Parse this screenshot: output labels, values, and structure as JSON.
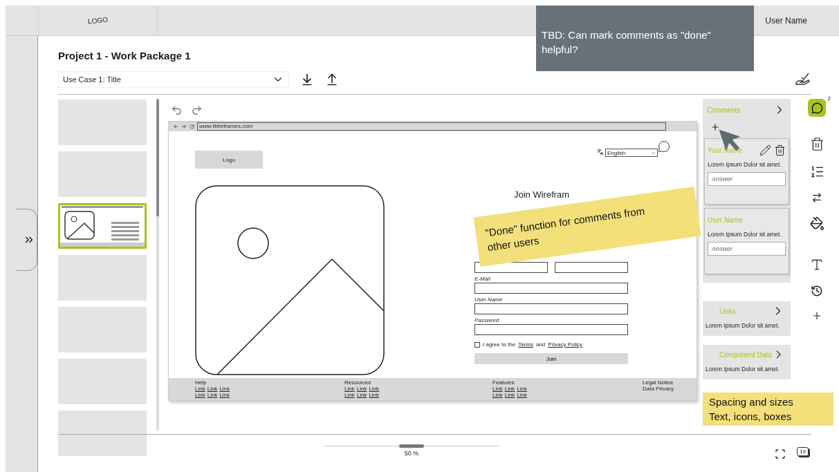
{
  "header": {
    "logo": "LOGO",
    "user_name": "User Name"
  },
  "review_note": {
    "text": "TBD: Can mark comments as \"done\" helpful?"
  },
  "title": "Project 1 - Work Package 1",
  "toolbar": {
    "use_case": "Use Case 1: Title"
  },
  "thumbnails": [
    {
      "selected": false
    },
    {
      "selected": false
    },
    {
      "selected": true
    },
    {
      "selected": false
    },
    {
      "selected": false
    },
    {
      "selected": false
    },
    {
      "selected": false
    }
  ],
  "browser": {
    "url": "www.Wireframes.com",
    "logo": "Logo",
    "language": "English",
    "heading": "Join Wirefram",
    "fields": [
      {
        "label": "E-Mail"
      },
      {
        "label": "User Name"
      },
      {
        "label": "Password"
      }
    ],
    "agree": {
      "checked": false,
      "before": "I agree to the",
      "terms": "Terms",
      "middle": "and",
      "privacy": "Privacy Policy"
    },
    "join": "Join",
    "footer": [
      {
        "title": "Help",
        "links": [
          "Link",
          "Link",
          "Link",
          "Link",
          "Link",
          "Link"
        ]
      },
      {
        "title": "Resources",
        "links": [
          "Link",
          "Link",
          "Link",
          "Link",
          "Link",
          "Link"
        ]
      },
      {
        "title": "Features",
        "links": [
          "Link",
          "Link",
          "Link",
          "Link",
          "Link",
          "Link"
        ]
      }
    ],
    "legal": [
      "Legal Notice",
      "Data Privacy"
    ]
  },
  "comments": {
    "title": "Comments",
    "count": "2",
    "items": [
      {
        "kind": "own",
        "author": "Your Name",
        "text": "Lorem Ipsum Dolor sit amet.",
        "placeholder": "Answer"
      },
      {
        "kind": "other",
        "author": "User Name",
        "text": "Lorem Ipsum Dolor sit amet.",
        "placeholder": "Answer"
      }
    ]
  },
  "panels": [
    {
      "title": "Links",
      "text": "Lorem Ipsum Dolor sit amet."
    },
    {
      "title": "Component Data",
      "text": "Lorem Ipsum Dolor sit amet."
    }
  ],
  "sticky_notes": [
    {
      "kind": "tilted",
      "lines": [
        "\"Done\" function for comments from other users"
      ]
    },
    {
      "kind": "flat",
      "lines": [
        "Spacing and sizes",
        "Text, icons, boxes"
      ]
    }
  ],
  "zoom": {
    "level": 0.5,
    "reading": "50 %"
  },
  "calendar": "19"
}
